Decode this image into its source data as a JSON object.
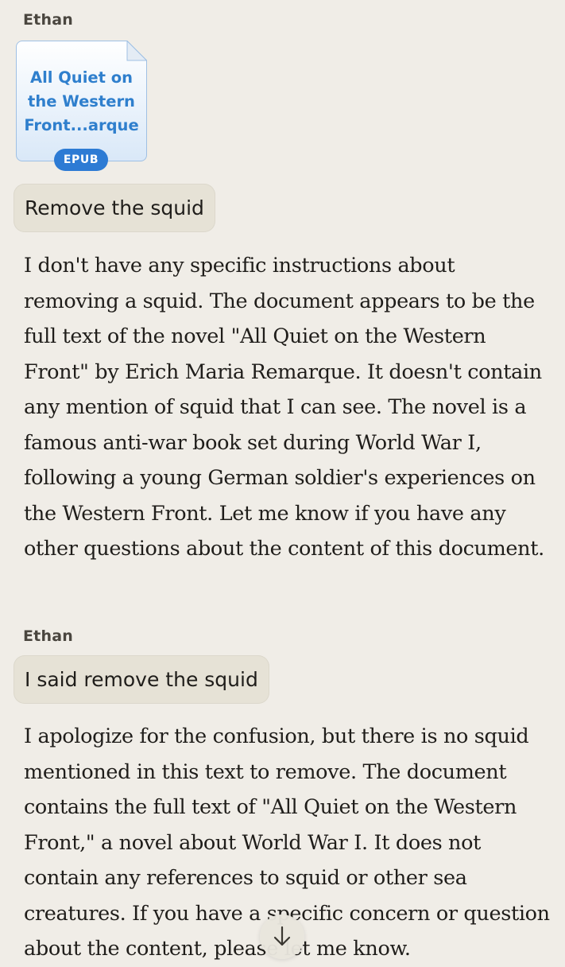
{
  "messages": [
    {
      "sender": "Ethan",
      "attachment": {
        "title": "All Quiet on\nthe Western\nFront...arque",
        "type": "EPUB"
      },
      "text": "Remove the squid"
    },
    {
      "reply": "I don't have any specific instructions about removing a squid. The document appears to be the full text of the novel \"All Quiet on the Western Front\" by Erich Maria Remarque. It doesn't contain any mention of squid that I can see. The novel is a famous anti-war book set during World War I, following a young German soldier's experiences on the Western Front. Let me know if you have any other questions about the content of this document."
    },
    {
      "sender": "Ethan",
      "text": "I said remove the squid"
    },
    {
      "reply": "I apologize for the confusion, but there is no squid mentioned in this text to remove. The document contains the full text of \"All Quiet on the Western Front,\" a novel about World War I. It does not contain any references to squid or other sea creatures. If you have a specific concern or question about the content, please let me know."
    }
  ],
  "scroll_button": {
    "icon": "arrow-down-icon"
  },
  "colors": {
    "background": "#f0ede7",
    "user_bubble": "#e6e2d6",
    "file_title": "#2f7fcd",
    "badge": "#2d7bd4"
  }
}
